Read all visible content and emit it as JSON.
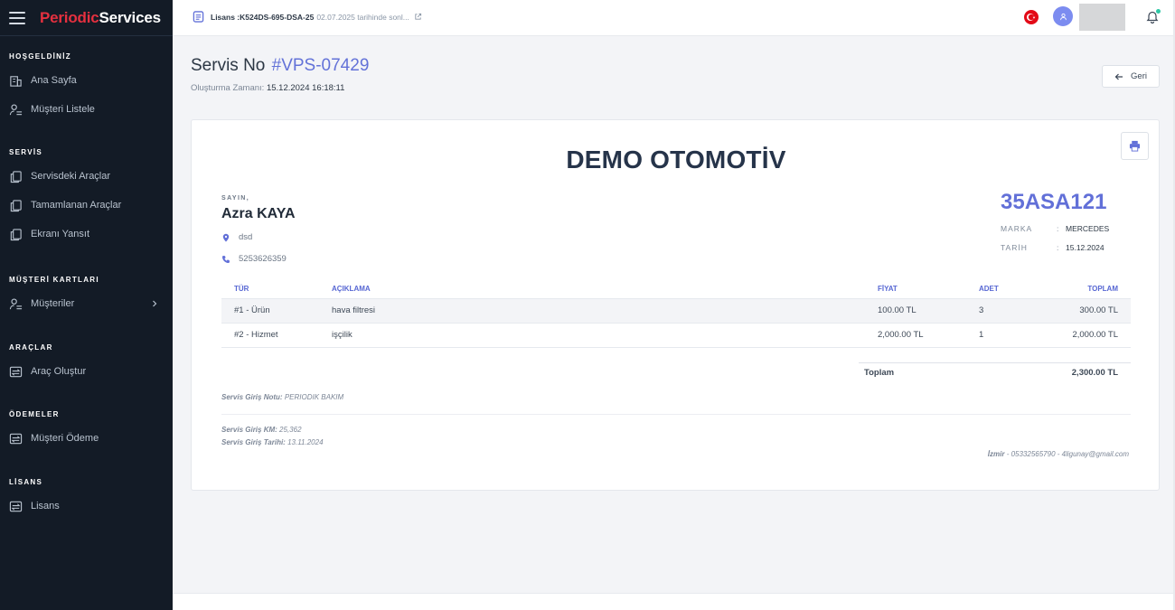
{
  "sidebar": {
    "brand_a": "Periodic",
    "brand_b": "Services",
    "sections": [
      {
        "title": "HOŞGELDİNİZ",
        "items": [
          {
            "label": "Ana Sayfa",
            "icon": "building-icon"
          },
          {
            "label": "Müşteri Listele",
            "icon": "user-list-icon"
          }
        ]
      },
      {
        "title": "SERVİS",
        "items": [
          {
            "label": "Servisdeki Araçlar",
            "icon": "copy-icon"
          },
          {
            "label": "Tamamlanan Araçlar",
            "icon": "copy-icon"
          },
          {
            "label": "Ekranı Yansıt",
            "icon": "copy-icon"
          }
        ]
      },
      {
        "title": "MÜŞTERİ KARTLARI",
        "items": [
          {
            "label": "Müşteriler",
            "icon": "user-list-icon"
          }
        ]
      },
      {
        "title": "ARAÇLAR",
        "items": [
          {
            "label": "Araç Oluştur",
            "icon": "exchange-icon"
          }
        ]
      },
      {
        "title": "ÖDEMELER",
        "items": [
          {
            "label": "Müşteri Ödeme",
            "icon": "exchange-icon"
          }
        ]
      },
      {
        "title": "LİSANS",
        "items": [
          {
            "label": "Lisans",
            "icon": "exchange-icon"
          }
        ]
      }
    ]
  },
  "topbar": {
    "license_label": "Lisans :K524DS-695-DSA-25",
    "license_date": "02.07.2025 tarihinde sonl..."
  },
  "header": {
    "title_label": "Servis No",
    "service_no": "#VPS-07429",
    "created_label": "Oluşturma Zamanı:",
    "created_value": "15.12.2024 16:18:11",
    "back_label": "Geri"
  },
  "invoice": {
    "company": "DEMO OTOMOTİV",
    "salutation": "SAYIN,",
    "customer_name": "Azra KAYA",
    "address": "dsd",
    "phone": "5253626359",
    "plate": "35ASA121",
    "brand_label": "MARKA",
    "brand_value": "MERCEDES",
    "date_label": "TARİH",
    "date_value": "15.12.2024",
    "columns": [
      "TÜR",
      "AÇIKLAMA",
      "FİYAT",
      "ADET",
      "TOPLAM"
    ],
    "rows": [
      {
        "type": "#1 - Ürün",
        "desc": "hava filtresi",
        "price": "100.00 TL",
        "qty": "3",
        "total": "300.00 TL"
      },
      {
        "type": "#2 - Hizmet",
        "desc": "işçilik",
        "price": "2,000.00 TL",
        "qty": "1",
        "total": "2,000.00 TL"
      }
    ],
    "grand_total_label": "Toplam",
    "grand_total_value": "2,300.00 TL",
    "entry_note_label": "Servis Giriş Notu:",
    "entry_note_value": "PERIODIK BAKIM",
    "entry_km_label": "Servis Giriş KM:",
    "entry_km_value": "25,362",
    "entry_date_label": "Servis Giriş Tarihi:",
    "entry_date_value": "13.11.2024",
    "contact_city": "İzmir",
    "contact_rest": "- 05332565790 - 4ligunay@gmail.com"
  },
  "colors": {
    "sidebar_bg": "#131b26",
    "accent": "#6270d8",
    "brand_red": "#e5303f"
  }
}
